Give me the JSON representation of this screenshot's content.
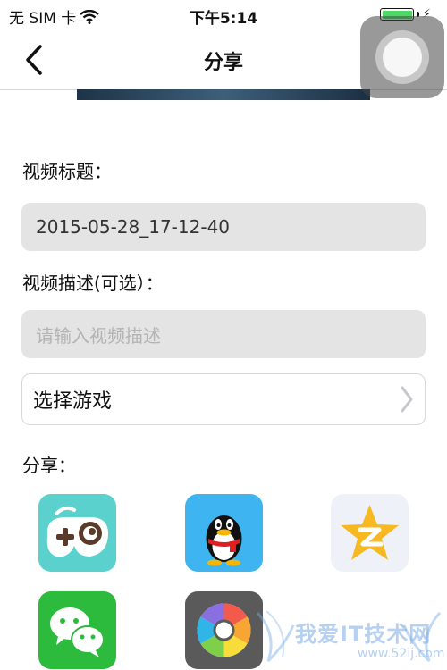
{
  "status_bar": {
    "carrier": "无 SIM 卡",
    "time": "下午5:14",
    "battery_color": "#4cd964"
  },
  "nav": {
    "back_icon": "chevron-left-icon",
    "title": "分享"
  },
  "form": {
    "title_label": "视频标题：",
    "title_value": "2015-05-28_17-12-40",
    "desc_label": "视频描述(可选）：",
    "desc_placeholder": "请输入视频描述",
    "select_game_label": "选择游戏",
    "share_label": "分享："
  },
  "share_targets": [
    {
      "name": "game-app",
      "icon": "gamepad-icon",
      "color": "#5ad1cc"
    },
    {
      "name": "qq",
      "icon": "qq-penguin-icon",
      "color": "#3eb5f1"
    },
    {
      "name": "qzone",
      "icon": "qzone-star-icon",
      "color": "#eef2f8"
    },
    {
      "name": "wechat",
      "icon": "wechat-icon",
      "color": "#2dbb3d"
    },
    {
      "name": "moments",
      "icon": "aperture-icon",
      "color": "#5a5a5a"
    }
  ],
  "watermark": {
    "text": "我爱IT技术网",
    "sub": "www.52ij.com"
  }
}
